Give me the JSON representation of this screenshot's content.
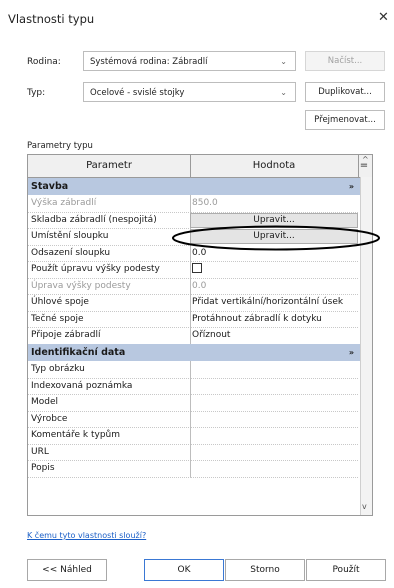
{
  "window": {
    "title": "Vlastnosti typu",
    "close_glyph": "✕"
  },
  "family": {
    "label": "Rodina:",
    "value": "Systémová rodina: Zábradlí",
    "load_button": "Načíst..."
  },
  "type": {
    "label": "Typ:",
    "value": "Ocelové - svislé stojky",
    "duplicate_button": "Duplikovat...",
    "rename_button": "Přejmenovat..."
  },
  "params_label": "Parametry typu",
  "grid": {
    "header": {
      "param": "Parametr",
      "value": "Hodnota",
      "eq": "="
    },
    "section1": {
      "title": "Stavba",
      "collapse": "»"
    },
    "rows1": [
      {
        "k": "Výška zábradlí",
        "v": "850.0"
      },
      {
        "k": "Skladba zábradlí (nespojitá)",
        "v": "Upravit..."
      },
      {
        "k": "Umístění sloupku",
        "v": "Upravit..."
      },
      {
        "k": "Odsazení sloupku",
        "v": "0.0"
      },
      {
        "k": "Použít úpravu výšky podesty",
        "v": ""
      },
      {
        "k": "Úprava výšky podesty",
        "v": "0.0"
      },
      {
        "k": "Úhlové spoje",
        "v": "Přidat vertikální/horizontální úsek"
      },
      {
        "k": "Tečné spoje",
        "v": "Protáhnout zábradlí k dotyku"
      },
      {
        "k": "Připoje zábradlí",
        "v": "Oříznout"
      }
    ],
    "section2": {
      "title": "Identifikační data",
      "collapse": "»"
    },
    "rows2": [
      {
        "k": "Typ obrázku",
        "v": ""
      },
      {
        "k": "Indexovaná poznámka",
        "v": ""
      },
      {
        "k": "Model",
        "v": ""
      },
      {
        "k": "Výrobce",
        "v": ""
      },
      {
        "k": "Komentáře k typům",
        "v": ""
      },
      {
        "k": "URL",
        "v": ""
      },
      {
        "k": "Popis",
        "v": ""
      }
    ]
  },
  "help_link": "K čemu tyto vlastnosti slouží?",
  "buttons": {
    "preview": "<< Náhled",
    "ok": "OK",
    "cancel": "Storno",
    "apply": "Použít"
  },
  "icons": {
    "chevron": "chevron-down-icon",
    "close": "close-icon",
    "collapse": "collapse-icon"
  },
  "colors": {
    "section_bg": "#b8c8e0",
    "link": "#1b5fc7",
    "ok_border": "#3a78d4"
  }
}
